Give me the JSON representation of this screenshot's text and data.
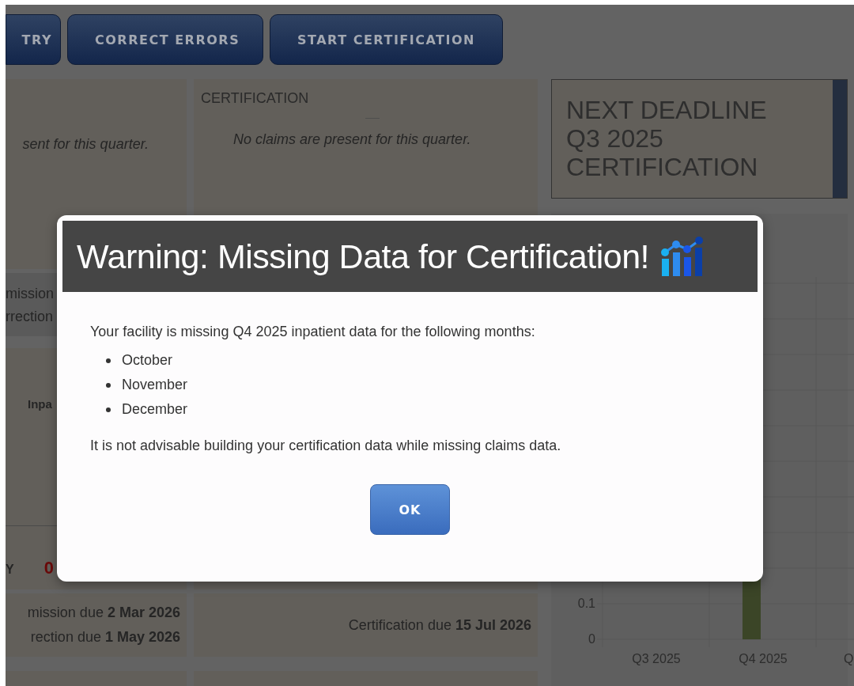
{
  "toolbar": {
    "buttons": [
      {
        "label": "TRY",
        "kind": "cut"
      },
      {
        "label": "CORRECT ERRORS",
        "kind": "full"
      },
      {
        "label": "START CERTIFICATION",
        "kind": "full"
      }
    ]
  },
  "submission_panel": {
    "message": "sent for this quarter.",
    "lines": [
      "mission",
      "rrection"
    ],
    "table_heading": "Inpa",
    "total_label": "Y",
    "total_value": "0",
    "deadlines": [
      {
        "label": "mission due ",
        "date": "2 Mar 2026"
      },
      {
        "label": "rection due ",
        "date": "1 May 2026"
      }
    ]
  },
  "certification_panel": {
    "title": "CERTIFICATION",
    "message": "No claims are present for this quarter.",
    "deadline": {
      "label": "Certification due ",
      "date": "15 Jul 2026"
    }
  },
  "next_deadline": {
    "lines": [
      "NEXT DEADLINE",
      "Q3 2025",
      "CERTIFICATION"
    ]
  },
  "chart": {
    "y_tick_labels": [
      "0.1",
      "0"
    ],
    "x_labels": [
      "Q3 2025",
      "Q4 2025",
      "Q"
    ]
  },
  "dialog": {
    "title": "Warning: Missing Data for Certification!",
    "intro": "Your facility is missing Q4 2025 inpatient data for the following months:",
    "months": [
      "October",
      "November",
      "December"
    ],
    "note": "It is not advisable building your certification data while missing claims data.",
    "button": "OK"
  }
}
